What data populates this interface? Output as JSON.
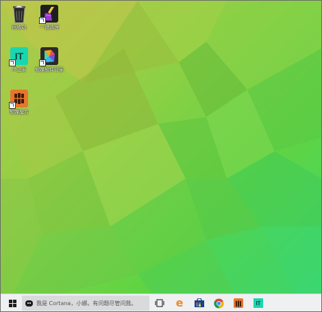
{
  "desktop": {
    "icons": [
      {
        "label": "回收站",
        "icon": "recycle-bin-icon"
      },
      {
        "label": "一键清理",
        "icon": "broom-icon"
      },
      {
        "label": "IT之家",
        "icon": "ithome-icon",
        "badge": "IT"
      },
      {
        "label": "软媒软件管家",
        "icon": "software-manager-icon"
      },
      {
        "label": "软媒魔方",
        "icon": "rubik-cube-icon"
      }
    ]
  },
  "taskbar": {
    "search_placeholder": "我是 Cortana，小娜。有问题尽管问我。",
    "pinned": [
      {
        "name": "task-view",
        "icon": "task-view-icon"
      },
      {
        "name": "edge",
        "icon": "edge-icon",
        "glyph": "e"
      },
      {
        "name": "store",
        "icon": "store-icon"
      },
      {
        "name": "chrome",
        "icon": "chrome-icon"
      },
      {
        "name": "rubik-cube",
        "icon": "rubik-cube-icon"
      },
      {
        "name": "ithome",
        "icon": "ithome-icon",
        "badge": "IT"
      }
    ]
  },
  "colors": {
    "wallpaper_top_left": "#b3c84a",
    "wallpaper_bottom_right": "#3fd76a",
    "taskbar_bg": "#eef0f1",
    "search_bg": "#d9dadb",
    "ithome_teal": "#19d6b0",
    "rubik_orange": "#e8762b",
    "edge_orange": "#f08a24"
  }
}
